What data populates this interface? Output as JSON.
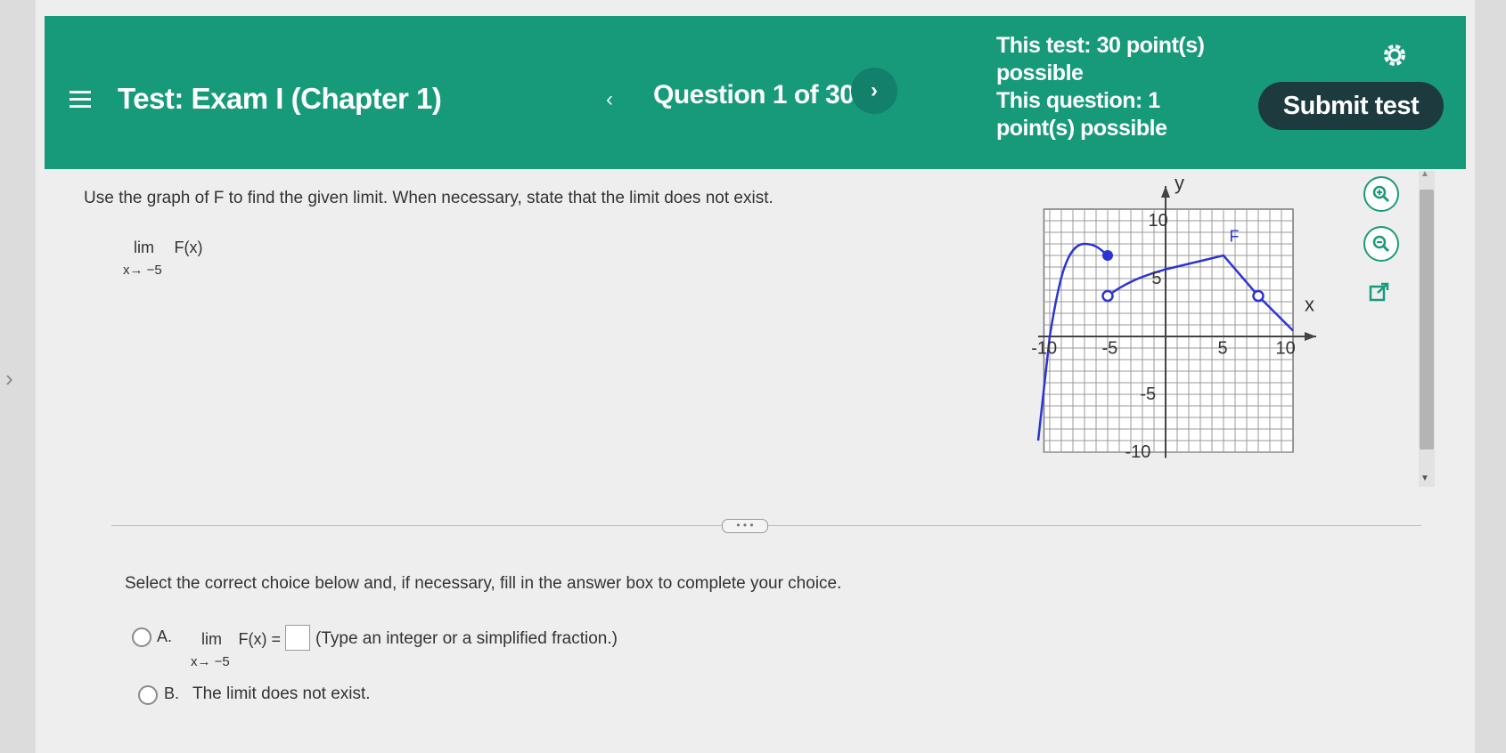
{
  "header": {
    "title": "Test: Exam I (Chapter 1)",
    "question_label": "Question 1 of 30",
    "points_line1": "This test: 30 point(s)",
    "points_line2": "possible",
    "points_line3": "This question: 1",
    "points_line4": "point(s) possible",
    "submit_label": "Submit test",
    "icons": [
      "menu-icon",
      "previous-chevron-icon",
      "next-chevron-icon",
      "gear-icon"
    ]
  },
  "question": {
    "prompt": "Use the graph of F to find the given limit. When necessary, state that the limit does not exist.",
    "limit_word": "lim",
    "limit_function": "F(x)",
    "limit_subscript": "x→ −5"
  },
  "graph": {
    "y_axis_label": "y",
    "x_axis_label": "x",
    "function_label": "F",
    "tick_labels": {
      "x_neg10": "-10",
      "x_neg5": "-5",
      "x_5": "5",
      "x_10": "10",
      "y_10": "10",
      "y_5": "5",
      "y_neg5": "-5",
      "y_neg10": "-10"
    },
    "curve_color": "#2b35d6",
    "grid_range": {
      "x": [
        -10,
        10
      ],
      "y": [
        -10,
        10
      ]
    }
  },
  "tools": [
    "zoom-in-icon",
    "zoom-out-icon",
    "popout-icon"
  ],
  "answer": {
    "instruction": "Select the correct choice below and, if necessary, fill in the answer box to complete your choice.",
    "choice_a_letter": "A.",
    "choice_a_lim": "lim",
    "choice_a_function": "F(x) =",
    "choice_a_subscript": "x→ −5",
    "choice_a_hint": "(Type an integer or a simplified fraction.)",
    "choice_b_letter": "B.",
    "choice_b_text": "The limit does not exist.",
    "answer_value": ""
  },
  "colors": {
    "header_bg": "#169a7a",
    "submit_bg": "#1d3a3f",
    "accent": "#1a9a7c"
  }
}
